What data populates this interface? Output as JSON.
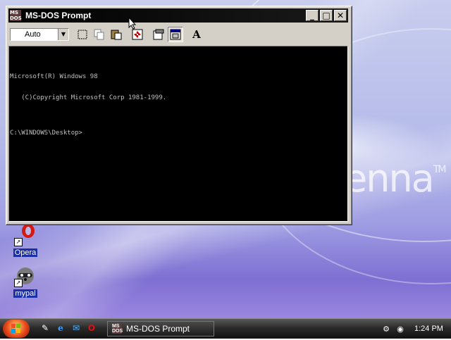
{
  "window": {
    "title": "MS-DOS Prompt",
    "icon_glyph": "MS\nDOS",
    "minimize_glyph": "_",
    "maximize_glyph": "□",
    "close_glyph": "✕"
  },
  "toolbar": {
    "font_size_value": "Auto",
    "buttons": [
      "mark-icon",
      "copy-icon",
      "paste-icon",
      "fullscreen-icon",
      "properties-icon",
      "background-icon",
      "font-icon"
    ],
    "font_button_glyph": "A"
  },
  "console": {
    "lines": [
      "Microsoft(R) Windows 98",
      "   (C)Copyright Microsoft Corp 1981-1999.",
      "",
      "C:\\WINDOWS\\Desktop>"
    ]
  },
  "desktop": {
    "icons": [
      {
        "label": "Opera",
        "icon": "opera-icon"
      },
      {
        "label": "mypal",
        "icon": "mypal-raccoon-icon"
      }
    ],
    "wallpaper_text": "enna",
    "wallpaper_tm": "TM"
  },
  "taskbar": {
    "task_label": "MS-DOS Prompt",
    "clock": "1:24 PM",
    "quick_launch": [
      "notepad-icon",
      "ie-icon",
      "outlook-icon",
      "opera-icon"
    ],
    "tray": [
      "network-icon",
      "antivirus-icon"
    ]
  },
  "colors": {
    "titlebar": "#000000",
    "console_bg": "#000000",
    "console_text": "#c0c0c0",
    "icon_label_bg": "#1a2fa8"
  }
}
